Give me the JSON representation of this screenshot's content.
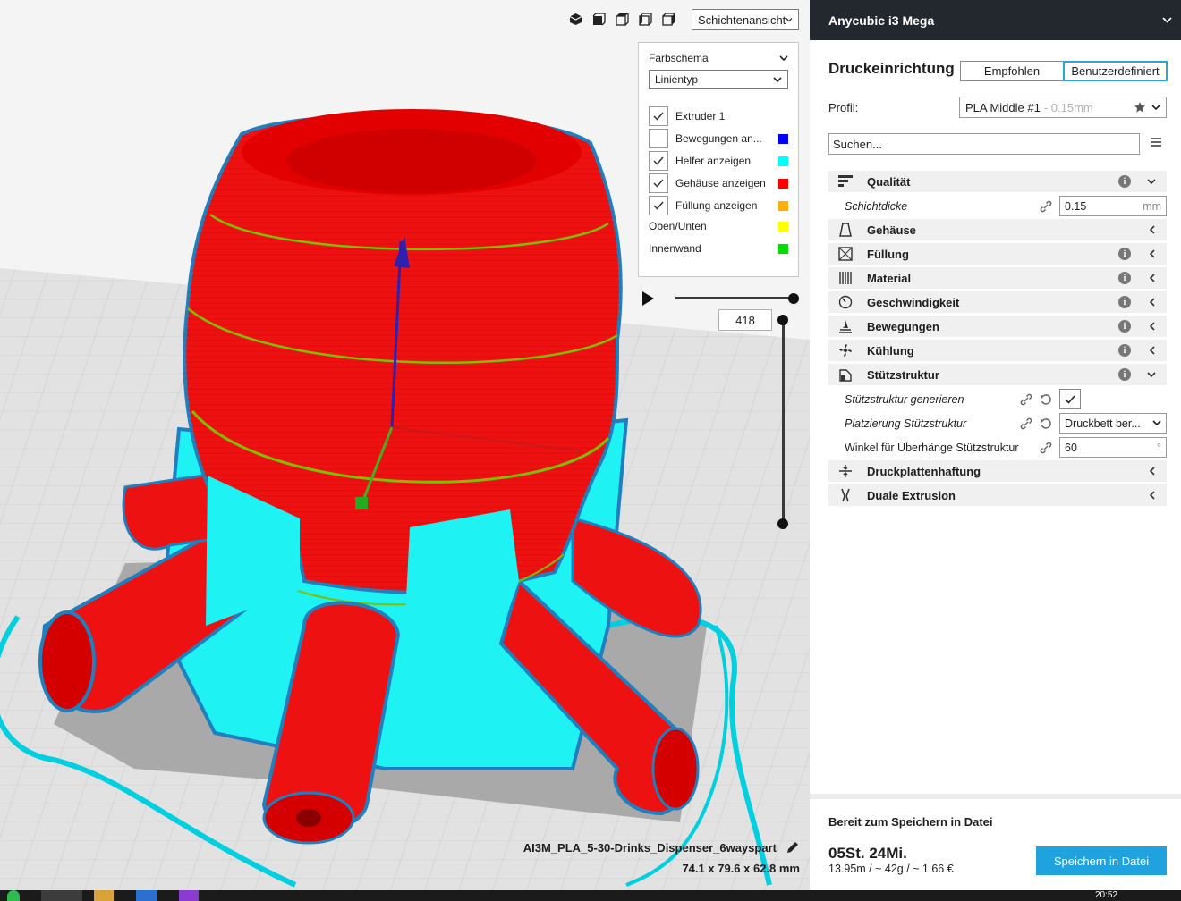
{
  "viewport": {
    "view_mode": "Schichtenansicht",
    "view_icons": [
      "3d-view-icon",
      "front-view-icon",
      "top-view-icon",
      "left-view-icon",
      "right-view-icon"
    ],
    "legend": {
      "scheme_label": "Farbschema",
      "scheme_value": "Linientyp",
      "items": [
        {
          "label": "Extruder 1",
          "checkbox": true,
          "checked": true,
          "color": ""
        },
        {
          "label": "Bewegungen an...",
          "checkbox": true,
          "checked": false,
          "color": "#0000ff"
        },
        {
          "label": "Helfer anzeigen",
          "checkbox": true,
          "checked": true,
          "color": "#00ffff"
        },
        {
          "label": "Gehäuse anzeigen",
          "checkbox": true,
          "checked": true,
          "color": "#ff0000"
        },
        {
          "label": "Füllung anzeigen",
          "checkbox": true,
          "checked": true,
          "color": "#ffb000"
        },
        {
          "label": "Oben/Unten",
          "checkbox": false,
          "checked": false,
          "color": "#ffff00"
        },
        {
          "label": "Innenwand",
          "checkbox": false,
          "checked": false,
          "color": "#00e000"
        }
      ]
    },
    "layer": "418",
    "file_name": "AI3M_PLA_5-30-Drinks_Dispenser_6wayspart",
    "dimensions": "74.1 x 79.6 x 62.8 mm"
  },
  "panel": {
    "printer": "Anycubic i3 Mega",
    "setup_title": "Druckeinrichtung",
    "mode_recommended": "Empfohlen",
    "mode_custom": "Benutzerdefiniert",
    "profile_label": "Profil:",
    "profile_value": "PLA Middle #1",
    "profile_sub": "- 0.15mm",
    "search_placeholder": "Suchen...",
    "categories": {
      "quality": "Qualität",
      "shell": "Gehäuse",
      "infill": "Füllung",
      "material": "Material",
      "speed": "Geschwindigkeit",
      "travel": "Bewegungen",
      "cooling": "Kühlung",
      "support": "Stützstruktur",
      "adhesion": "Druckplattenhaftung",
      "dual": "Duale Extrusion"
    },
    "settings": {
      "layer_height_label": "Schichtdicke",
      "layer_height_value": "0.15",
      "layer_height_unit": "mm",
      "support_gen_label": "Stützstruktur generieren",
      "support_place_label": "Platzierung Stützstruktur",
      "support_place_value": "Druckbett ber...",
      "overhang_label": "Winkel für Überhänge Stützstruktur",
      "overhang_value": "60",
      "overhang_unit": "°"
    },
    "status": "Bereit zum Speichern in Datei",
    "print_time": "05St. 24Mi.",
    "print_details": "13.95m / ~ 42g / ~ 1.66 €",
    "save_label": "Speichern in Datei"
  },
  "taskbar": {
    "clock": "20:52"
  }
}
